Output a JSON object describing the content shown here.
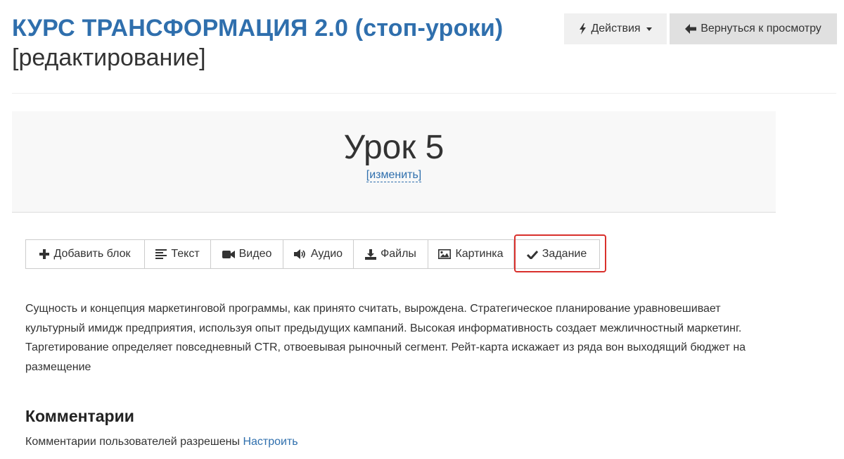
{
  "header": {
    "course_title": "КУРС ТРАНСФОРМАЦИЯ 2.0 (стоп-уроки)",
    "editing_label": "[редактирование]",
    "actions_label": "Действия",
    "back_label": "Вернуться к просмотру"
  },
  "lesson": {
    "title": "Урок 5",
    "edit_link": "[изменить]"
  },
  "toolbar": {
    "items": [
      {
        "label": "Добавить блок",
        "icon": "plus-icon"
      },
      {
        "label": "Текст",
        "icon": "align-left-icon"
      },
      {
        "label": "Видео",
        "icon": "video-camera-icon"
      },
      {
        "label": "Аудио",
        "icon": "volume-icon"
      },
      {
        "label": "Файлы",
        "icon": "download-icon"
      },
      {
        "label": "Картинка",
        "icon": "picture-icon"
      },
      {
        "label": "Задание",
        "icon": "checkmark-icon"
      }
    ],
    "highlighted_item": "Задание",
    "highlight_color": "#d9302c"
  },
  "content": {
    "paragraph": "Сущность и концепция маркетинговой программы, как принято считать, вырождена. Стратегическое планирование уравновешивает культурный имидж предприятия, используя опыт предыдущих кампаний. Высокая информативность создает межличностный маркетинг. Таргетирование определяет повседневный CTR, отвоевывая рыночный сегмент. Рейт-карта искажает из ряда вон выходящий бюджет на размещение"
  },
  "comments": {
    "title": "Комментарии",
    "status_text": "Комментарии пользователей разрешены",
    "configure_link": "Настроить"
  },
  "colors": {
    "accent": "#2f6fad",
    "text": "#333333",
    "panel_bg": "#f8f8f8"
  }
}
